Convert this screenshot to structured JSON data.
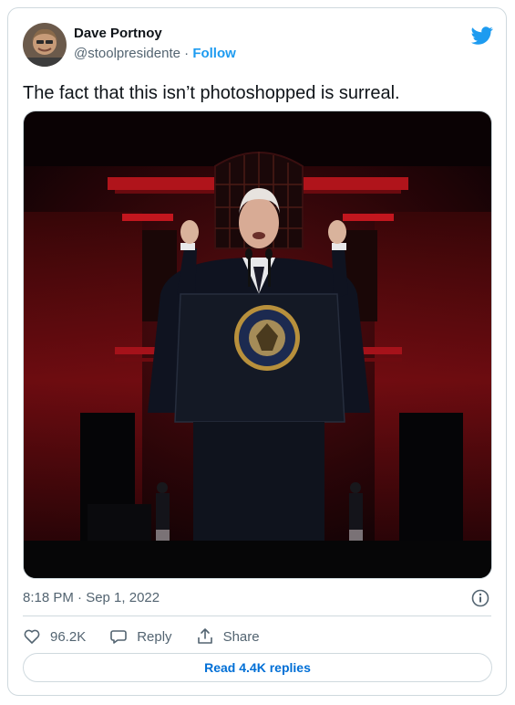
{
  "tweet": {
    "author_name": "Dave Portnoy",
    "handle": "@stoolpresidente",
    "separator": "·",
    "follow_label": "Follow",
    "text": "The fact that this isn’t photoshopped is surreal.",
    "timestamp": "8:18 PM · Sep 1, 2022",
    "likes_count": "96.2K",
    "reply_label": "Reply",
    "share_label": "Share",
    "read_replies_label": "Read 4.4K replies"
  },
  "icons": {
    "brand": "twitter-bird-icon",
    "info": "info-icon",
    "like": "heart-icon",
    "reply": "reply-bubble-icon",
    "share": "share-icon"
  },
  "colors": {
    "accent": "#1d9bf0",
    "link": "#006fd6",
    "secondary_text": "#536471",
    "border": "#cfd9de"
  }
}
